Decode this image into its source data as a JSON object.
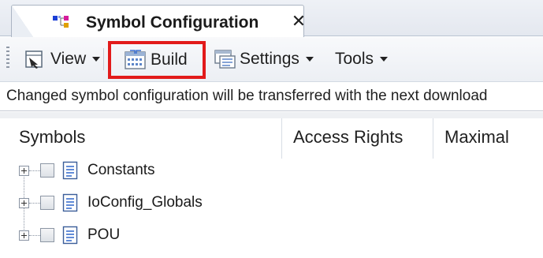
{
  "tab": {
    "title": "Symbol Configuration",
    "close_glyph": "✕",
    "icon": "symbol-configuration-icon"
  },
  "toolbar": {
    "view": {
      "label": "View",
      "icon": "view-icon",
      "has_dropdown": true
    },
    "build": {
      "label": "Build",
      "icon": "build-icon",
      "highlighted": true
    },
    "settings": {
      "label": "Settings",
      "icon": "settings-icon",
      "has_dropdown": true
    },
    "tools": {
      "label": "Tools",
      "has_dropdown": true
    }
  },
  "info_bar": {
    "message": "Changed symbol configuration will be transferred with the next download"
  },
  "grid": {
    "columns": [
      "Symbols",
      "Access Rights",
      "Maximal"
    ],
    "rows": [
      {
        "label": "Constants",
        "checked": false,
        "expandable": true,
        "icon": "document-icon"
      },
      {
        "label": "IoConfig_Globals",
        "checked": false,
        "expandable": true,
        "icon": "document-icon"
      },
      {
        "label": "POU",
        "checked": false,
        "expandable": true,
        "icon": "document-icon"
      }
    ]
  },
  "colors": {
    "highlight_border": "#e21a1a",
    "toolbar_bg": "#eef1f5",
    "tabstrip_bg": "#e8ecf2"
  }
}
